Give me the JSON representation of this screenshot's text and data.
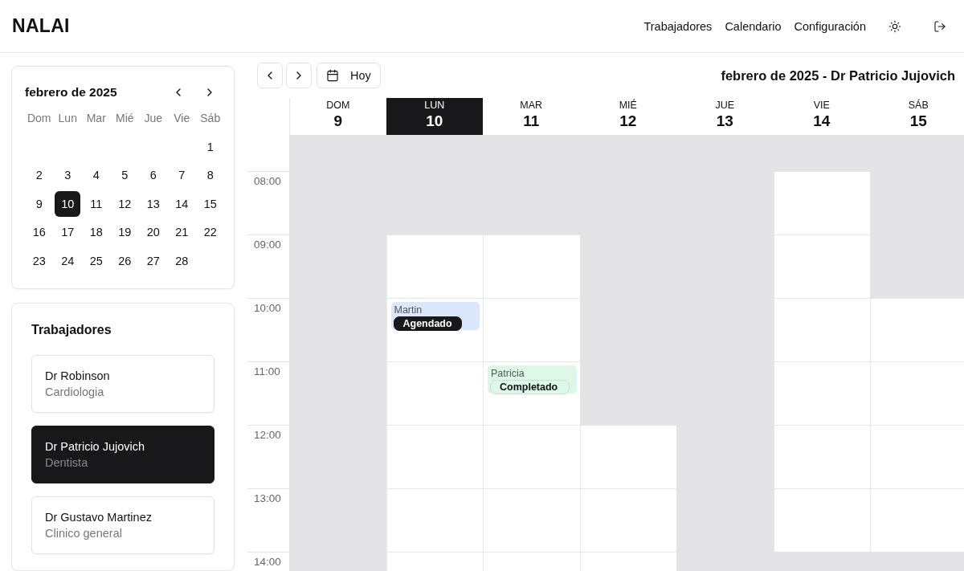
{
  "brand": "NALAI",
  "nav": [
    {
      "label": "Trabajadores"
    },
    {
      "label": "Calendario"
    },
    {
      "label": "Configuración"
    }
  ],
  "mini_calendar": {
    "title": "febrero de 2025",
    "weekdays": [
      "Dom",
      "Lun",
      "Mar",
      "Mié",
      "Jue",
      "Vie",
      "Sáb"
    ],
    "weeks": [
      {
        "kind": "first",
        "days": [
          {
            "day": "1",
            "selected": false
          }
        ]
      },
      {
        "kind": "full",
        "days": [
          {
            "day": "2",
            "selected": false
          },
          {
            "day": "3",
            "selected": false
          },
          {
            "day": "4",
            "selected": false
          },
          {
            "day": "5",
            "selected": false
          },
          {
            "day": "6",
            "selected": false
          },
          {
            "day": "7",
            "selected": false
          },
          {
            "day": "8",
            "selected": false
          }
        ]
      },
      {
        "kind": "full",
        "days": [
          {
            "day": "9",
            "selected": false
          },
          {
            "day": "10",
            "selected": true
          },
          {
            "day": "11",
            "selected": false
          },
          {
            "day": "12",
            "selected": false
          },
          {
            "day": "13",
            "selected": false
          },
          {
            "day": "14",
            "selected": false
          },
          {
            "day": "15",
            "selected": false
          }
        ]
      },
      {
        "kind": "full",
        "days": [
          {
            "day": "16",
            "selected": false
          },
          {
            "day": "17",
            "selected": false
          },
          {
            "day": "18",
            "selected": false
          },
          {
            "day": "19",
            "selected": false
          },
          {
            "day": "20",
            "selected": false
          },
          {
            "day": "21",
            "selected": false
          },
          {
            "day": "22",
            "selected": false
          }
        ]
      },
      {
        "kind": "last",
        "days": [
          {
            "day": "23",
            "selected": false
          },
          {
            "day": "24",
            "selected": false
          },
          {
            "day": "25",
            "selected": false
          },
          {
            "day": "26",
            "selected": false
          },
          {
            "day": "27",
            "selected": false
          },
          {
            "day": "28",
            "selected": false
          }
        ]
      }
    ]
  },
  "workers": {
    "title": "Trabajadores",
    "items": [
      {
        "name": "Dr Robinson",
        "specialty": "Cardiologia",
        "selected": false
      },
      {
        "name": "Dr Patricio Jujovich",
        "specialty": "Dentista",
        "selected": true
      },
      {
        "name": "Dr Gustavo Martinez",
        "specialty": "Clinico general",
        "selected": false
      }
    ]
  },
  "toolbar": {
    "today": "Hoy",
    "title": "febrero de 2025 - Dr Patricio Jujovich"
  },
  "days": [
    {
      "weekday": "DOM",
      "date": "9",
      "selected": false
    },
    {
      "weekday": "LUN",
      "date": "10",
      "selected": true
    },
    {
      "weekday": "MAR",
      "date": "11",
      "selected": false
    },
    {
      "weekday": "MIÉ",
      "date": "12",
      "selected": false
    },
    {
      "weekday": "JUE",
      "date": "13",
      "selected": false
    },
    {
      "weekday": "VIE",
      "date": "14",
      "selected": false
    },
    {
      "weekday": "SÁB",
      "date": "15",
      "selected": false
    }
  ],
  "slots": [
    {
      "cells": [
        {
          "available": false
        },
        {
          "available": false
        },
        {
          "available": false
        },
        {
          "available": false
        },
        {
          "available": false
        },
        {
          "available": false
        },
        {
          "available": false
        }
      ]
    },
    {
      "time": "08:00",
      "cells": [
        {
          "available": false
        },
        {
          "available": false
        },
        {
          "available": false
        },
        {
          "available": false
        },
        {
          "available": false
        },
        {
          "available": true
        },
        {
          "available": false
        }
      ]
    },
    {
      "time": "09:00",
      "cells": [
        {
          "available": false
        },
        {
          "available": true
        },
        {
          "available": true
        },
        {
          "available": false
        },
        {
          "available": false
        },
        {
          "available": true
        },
        {
          "available": false
        }
      ]
    },
    {
      "time": "10:00",
      "cells": [
        {
          "available": false
        },
        {
          "available": true,
          "event": {
            "patient": "Martin",
            "status": "Agendado",
            "kind": "scheduled",
            "color": "#dbe8fb"
          }
        },
        {
          "available": true
        },
        {
          "available": false
        },
        {
          "available": false
        },
        {
          "available": true
        },
        {
          "available": true
        }
      ]
    },
    {
      "time": "11:00",
      "cells": [
        {
          "available": false
        },
        {
          "available": true
        },
        {
          "available": true,
          "event": {
            "patient": "Patricia",
            "status": "Completado",
            "kind": "completed",
            "color": "#dcf8e7"
          }
        },
        {
          "available": false
        },
        {
          "available": false
        },
        {
          "available": true
        },
        {
          "available": true
        }
      ]
    },
    {
      "time": "12:00",
      "cells": [
        {
          "available": false
        },
        {
          "available": true
        },
        {
          "available": true
        },
        {
          "available": true
        },
        {
          "available": false
        },
        {
          "available": true
        },
        {
          "available": true
        }
      ]
    },
    {
      "time": "13:00",
      "cells": [
        {
          "available": false
        },
        {
          "available": true
        },
        {
          "available": true
        },
        {
          "available": true
        },
        {
          "available": false
        },
        {
          "available": true
        },
        {
          "available": true
        }
      ]
    },
    {
      "time": "14:00",
      "cells": [
        {
          "available": false
        },
        {
          "available": true
        },
        {
          "available": true
        },
        {
          "available": true
        },
        {
          "available": false
        },
        {
          "available": false
        },
        {
          "available": false
        }
      ]
    }
  ]
}
